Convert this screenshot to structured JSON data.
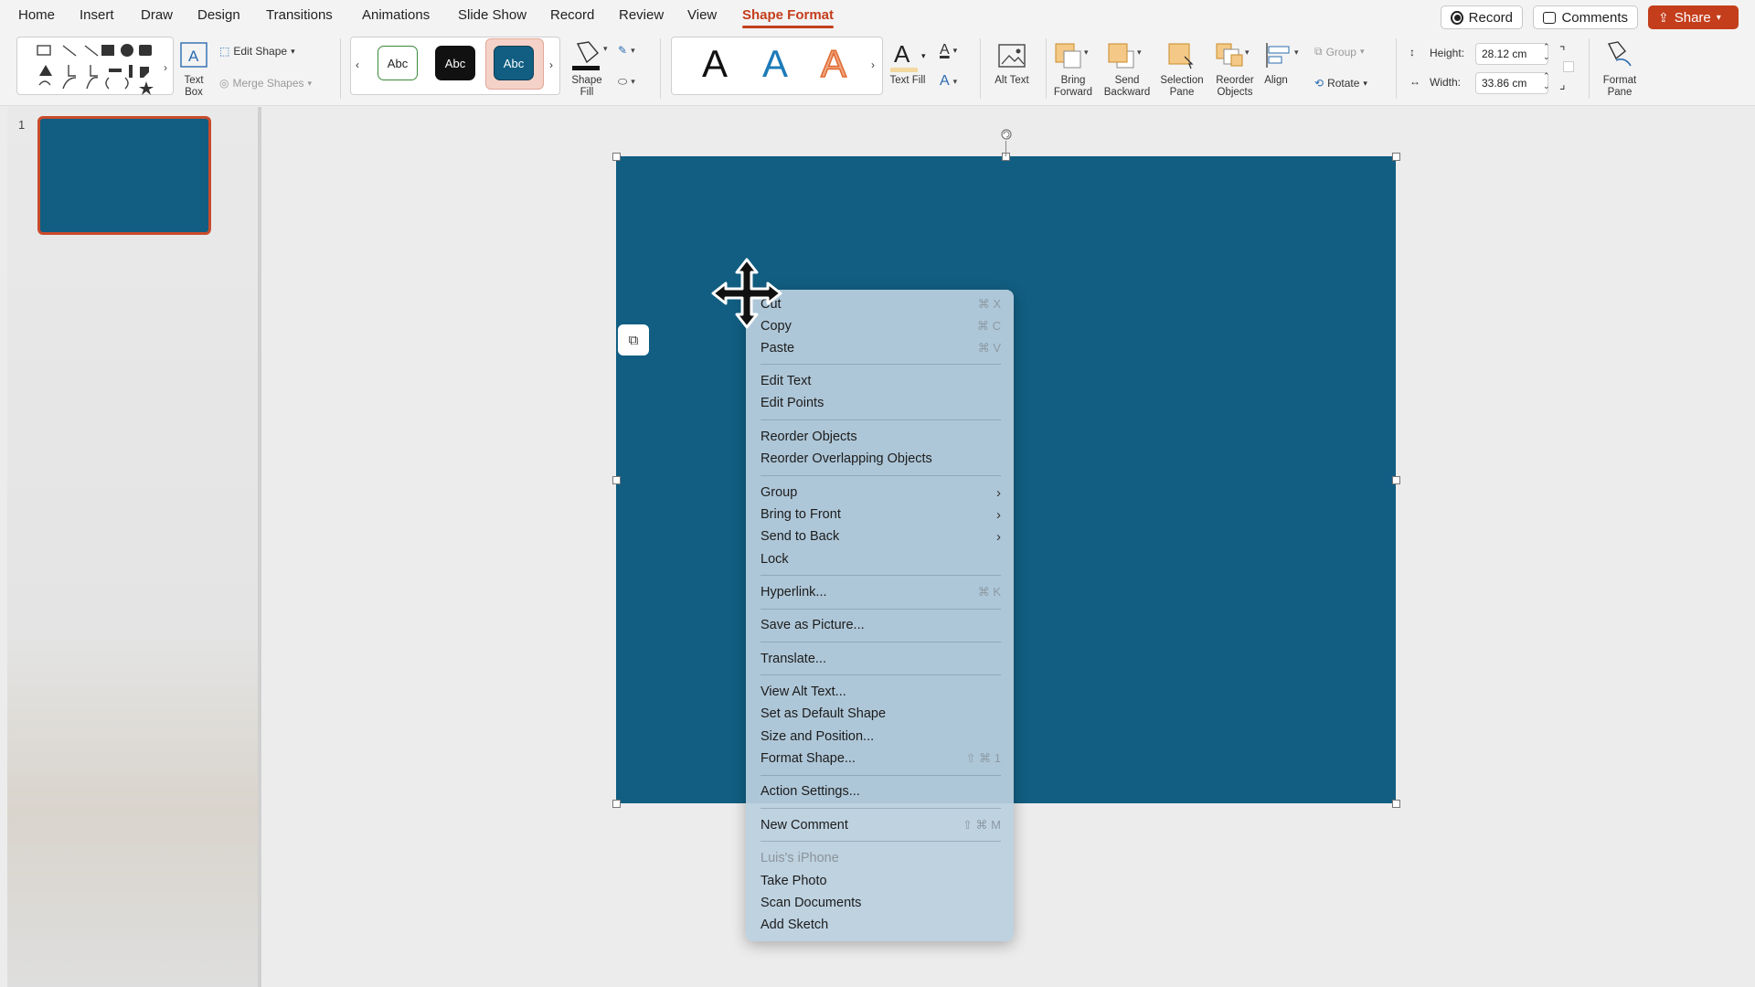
{
  "tabs": [
    "Home",
    "Insert",
    "Draw",
    "Design",
    "Transitions",
    "Animations",
    "Slide Show",
    "Record",
    "Review",
    "View",
    "Shape Format"
  ],
  "active_tab": "Shape Format",
  "top_actions": {
    "record": "Record",
    "comments": "Comments",
    "share": "Share"
  },
  "ribbon": {
    "text_box": "Text Box",
    "edit_shape": "Edit Shape",
    "merge_shapes": "Merge Shapes",
    "style_swatch": "Abc",
    "shape_fill": "Shape Fill",
    "wordart_letter": "A",
    "text_fill": "Text Fill",
    "alt_text": "Alt Text",
    "bring_forward": "Bring Forward",
    "send_backward": "Send Backward",
    "selection_pane": "Selection Pane",
    "reorder_objects": "Reorder Objects",
    "align": "Align",
    "group": "Group",
    "rotate": "Rotate",
    "height_label": "Height:",
    "height_value": "28.12 cm",
    "width_label": "Width:",
    "width_value": "33.86 cm",
    "format_pane": "Format Pane"
  },
  "thumbnails": {
    "slide_number": "1"
  },
  "slide": {
    "shape_color": "#115e82"
  },
  "context_menu": {
    "items": [
      {
        "label": "Cut",
        "shortcut": "⌘ X"
      },
      {
        "label": "Copy",
        "shortcut": "⌘ C"
      },
      {
        "label": "Paste",
        "shortcut": "⌘ V"
      },
      {
        "label": "Edit Text",
        "shortcut": ""
      },
      {
        "label": "Edit Points",
        "shortcut": ""
      },
      {
        "label": "Reorder Objects",
        "shortcut": ""
      },
      {
        "label": "Reorder Overlapping Objects",
        "shortcut": ""
      },
      {
        "label": "Group",
        "shortcut": "",
        "submenu": true
      },
      {
        "label": "Bring to Front",
        "shortcut": "",
        "submenu": true
      },
      {
        "label": "Send to Back",
        "shortcut": "",
        "submenu": true
      },
      {
        "label": "Lock",
        "shortcut": ""
      },
      {
        "label": "Hyperlink...",
        "shortcut": "⌘ K"
      },
      {
        "label": "Save as Picture...",
        "shortcut": ""
      },
      {
        "label": "Translate...",
        "shortcut": ""
      },
      {
        "label": "View Alt Text...",
        "shortcut": ""
      },
      {
        "label": "Set as Default Shape",
        "shortcut": ""
      },
      {
        "label": "Size and Position...",
        "shortcut": ""
      },
      {
        "label": "Format Shape...",
        "shortcut": "⇧ ⌘ 1"
      },
      {
        "label": "Action Settings...",
        "shortcut": ""
      },
      {
        "label": "New Comment",
        "shortcut": "⇧ ⌘ M"
      },
      {
        "label": "Luis's iPhone",
        "shortcut": "",
        "disabled": true
      },
      {
        "label": "Take Photo",
        "shortcut": ""
      },
      {
        "label": "Scan Documents",
        "shortcut": ""
      },
      {
        "label": "Add Sketch",
        "shortcut": ""
      }
    ]
  },
  "colors": {
    "accent": "#c43e1c",
    "slide_fill": "#115e82",
    "menu_bg": "#bad0df"
  }
}
